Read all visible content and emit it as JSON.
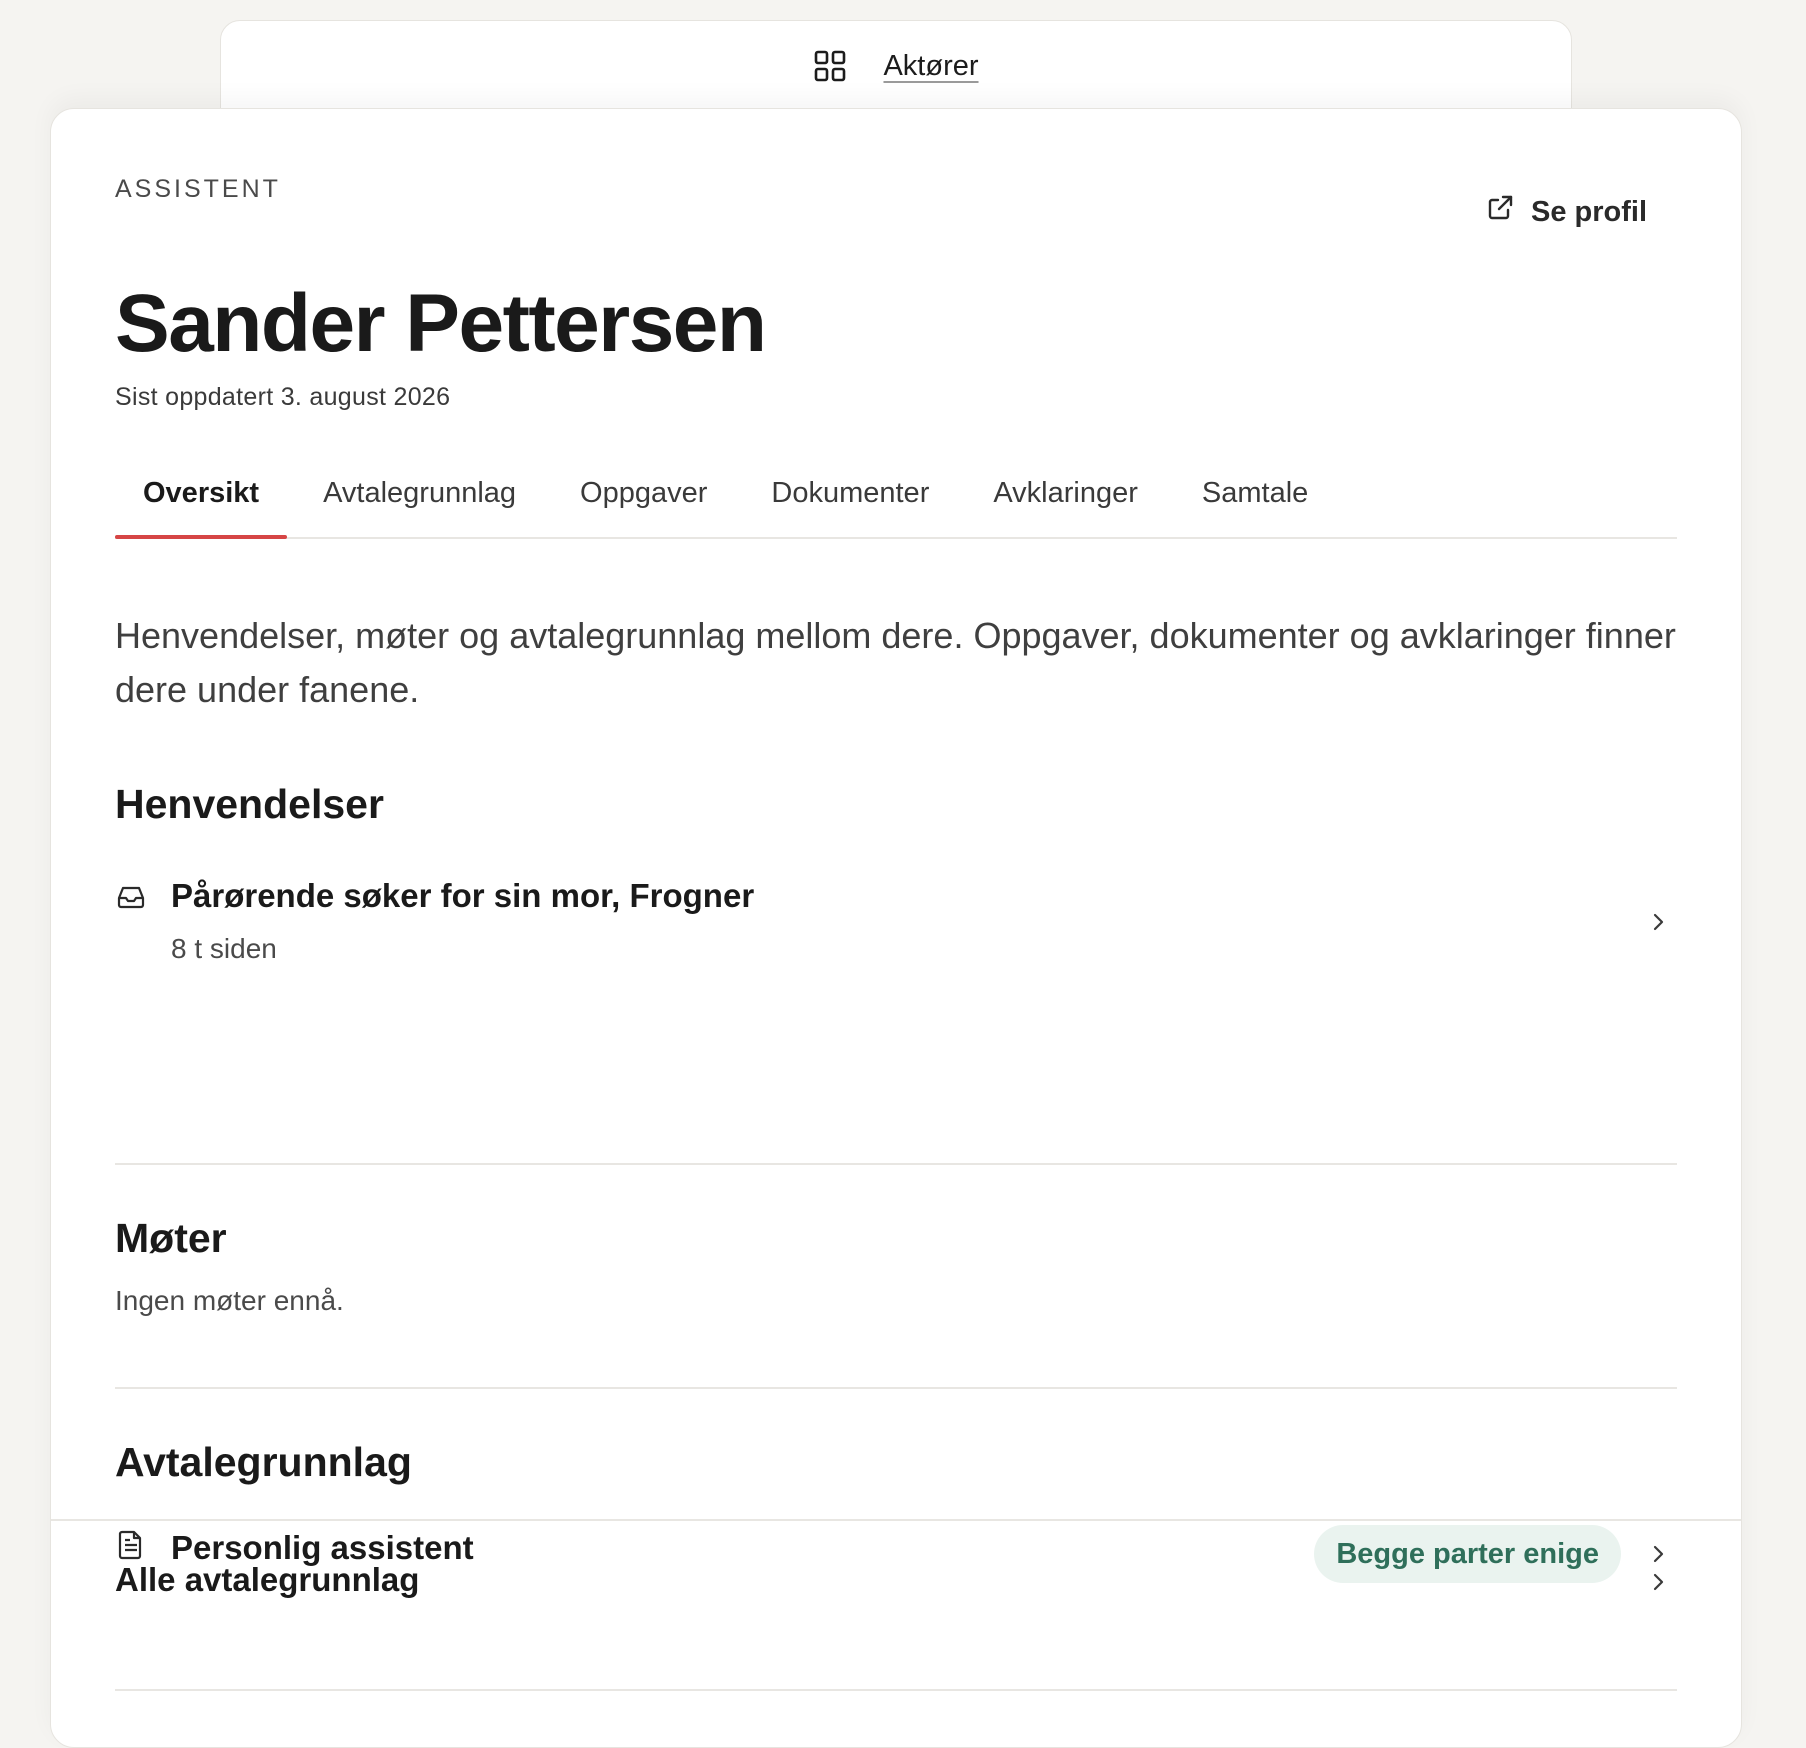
{
  "breadcrumb": {
    "icon": "grid-icon",
    "label": "Aktører"
  },
  "header": {
    "role": "ASSISTENT",
    "name": "Sander Pettersen",
    "updated": "Sist oppdatert 3. august 2026",
    "profile_link": "Se profil",
    "profile_icon": "external-link-icon"
  },
  "tabs": [
    {
      "label": "Oversikt",
      "active": true
    },
    {
      "label": "Avtalegrunnlag",
      "active": false
    },
    {
      "label": "Oppgaver",
      "active": false
    },
    {
      "label": "Dokumenter",
      "active": false
    },
    {
      "label": "Avklaringer",
      "active": false
    },
    {
      "label": "Samtale",
      "active": false
    }
  ],
  "intro": "Henvendelser, møter og avtalegrunnlag mellom dere. Oppgaver, dokumenter og avklaringer finner dere under fanene.",
  "henvendelser": {
    "title": "Henvendelser",
    "items": [
      {
        "title": "Pårørende søker for sin mor, Frogner",
        "time": "8 t siden",
        "icon": "inbox-icon"
      }
    ]
  },
  "moter": {
    "title": "Møter",
    "empty": "Ingen møter ennå."
  },
  "avtalegrunnlag": {
    "title": "Avtalegrunnlag",
    "items": [
      {
        "title": "Personlig assistent",
        "status": "Begge parter enige",
        "icon": "document-icon"
      }
    ],
    "all_link": "Alle avtalegrunnlag"
  },
  "colors": {
    "accent": "#d64545",
    "badge_bg": "#eaf3ef",
    "badge_text": "#2f6f5a"
  }
}
